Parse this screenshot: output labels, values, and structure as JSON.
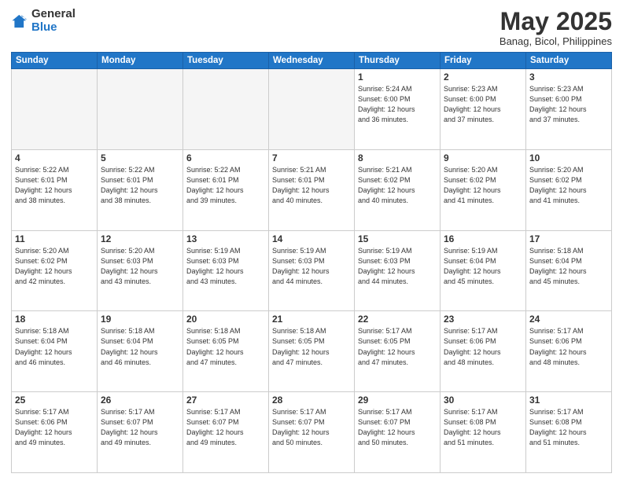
{
  "header": {
    "logo_general": "General",
    "logo_blue": "Blue",
    "month_title": "May 2025",
    "subtitle": "Banag, Bicol, Philippines"
  },
  "weekdays": [
    "Sunday",
    "Monday",
    "Tuesday",
    "Wednesday",
    "Thursday",
    "Friday",
    "Saturday"
  ],
  "weeks": [
    [
      {
        "day": "",
        "info": ""
      },
      {
        "day": "",
        "info": ""
      },
      {
        "day": "",
        "info": ""
      },
      {
        "day": "",
        "info": ""
      },
      {
        "day": "1",
        "info": "Sunrise: 5:24 AM\nSunset: 6:00 PM\nDaylight: 12 hours\nand 36 minutes."
      },
      {
        "day": "2",
        "info": "Sunrise: 5:23 AM\nSunset: 6:00 PM\nDaylight: 12 hours\nand 37 minutes."
      },
      {
        "day": "3",
        "info": "Sunrise: 5:23 AM\nSunset: 6:00 PM\nDaylight: 12 hours\nand 37 minutes."
      }
    ],
    [
      {
        "day": "4",
        "info": "Sunrise: 5:22 AM\nSunset: 6:01 PM\nDaylight: 12 hours\nand 38 minutes."
      },
      {
        "day": "5",
        "info": "Sunrise: 5:22 AM\nSunset: 6:01 PM\nDaylight: 12 hours\nand 38 minutes."
      },
      {
        "day": "6",
        "info": "Sunrise: 5:22 AM\nSunset: 6:01 PM\nDaylight: 12 hours\nand 39 minutes."
      },
      {
        "day": "7",
        "info": "Sunrise: 5:21 AM\nSunset: 6:01 PM\nDaylight: 12 hours\nand 40 minutes."
      },
      {
        "day": "8",
        "info": "Sunrise: 5:21 AM\nSunset: 6:02 PM\nDaylight: 12 hours\nand 40 minutes."
      },
      {
        "day": "9",
        "info": "Sunrise: 5:20 AM\nSunset: 6:02 PM\nDaylight: 12 hours\nand 41 minutes."
      },
      {
        "day": "10",
        "info": "Sunrise: 5:20 AM\nSunset: 6:02 PM\nDaylight: 12 hours\nand 41 minutes."
      }
    ],
    [
      {
        "day": "11",
        "info": "Sunrise: 5:20 AM\nSunset: 6:02 PM\nDaylight: 12 hours\nand 42 minutes."
      },
      {
        "day": "12",
        "info": "Sunrise: 5:20 AM\nSunset: 6:03 PM\nDaylight: 12 hours\nand 43 minutes."
      },
      {
        "day": "13",
        "info": "Sunrise: 5:19 AM\nSunset: 6:03 PM\nDaylight: 12 hours\nand 43 minutes."
      },
      {
        "day": "14",
        "info": "Sunrise: 5:19 AM\nSunset: 6:03 PM\nDaylight: 12 hours\nand 44 minutes."
      },
      {
        "day": "15",
        "info": "Sunrise: 5:19 AM\nSunset: 6:03 PM\nDaylight: 12 hours\nand 44 minutes."
      },
      {
        "day": "16",
        "info": "Sunrise: 5:19 AM\nSunset: 6:04 PM\nDaylight: 12 hours\nand 45 minutes."
      },
      {
        "day": "17",
        "info": "Sunrise: 5:18 AM\nSunset: 6:04 PM\nDaylight: 12 hours\nand 45 minutes."
      }
    ],
    [
      {
        "day": "18",
        "info": "Sunrise: 5:18 AM\nSunset: 6:04 PM\nDaylight: 12 hours\nand 46 minutes."
      },
      {
        "day": "19",
        "info": "Sunrise: 5:18 AM\nSunset: 6:04 PM\nDaylight: 12 hours\nand 46 minutes."
      },
      {
        "day": "20",
        "info": "Sunrise: 5:18 AM\nSunset: 6:05 PM\nDaylight: 12 hours\nand 47 minutes."
      },
      {
        "day": "21",
        "info": "Sunrise: 5:18 AM\nSunset: 6:05 PM\nDaylight: 12 hours\nand 47 minutes."
      },
      {
        "day": "22",
        "info": "Sunrise: 5:17 AM\nSunset: 6:05 PM\nDaylight: 12 hours\nand 47 minutes."
      },
      {
        "day": "23",
        "info": "Sunrise: 5:17 AM\nSunset: 6:06 PM\nDaylight: 12 hours\nand 48 minutes."
      },
      {
        "day": "24",
        "info": "Sunrise: 5:17 AM\nSunset: 6:06 PM\nDaylight: 12 hours\nand 48 minutes."
      }
    ],
    [
      {
        "day": "25",
        "info": "Sunrise: 5:17 AM\nSunset: 6:06 PM\nDaylight: 12 hours\nand 49 minutes."
      },
      {
        "day": "26",
        "info": "Sunrise: 5:17 AM\nSunset: 6:07 PM\nDaylight: 12 hours\nand 49 minutes."
      },
      {
        "day": "27",
        "info": "Sunrise: 5:17 AM\nSunset: 6:07 PM\nDaylight: 12 hours\nand 49 minutes."
      },
      {
        "day": "28",
        "info": "Sunrise: 5:17 AM\nSunset: 6:07 PM\nDaylight: 12 hours\nand 50 minutes."
      },
      {
        "day": "29",
        "info": "Sunrise: 5:17 AM\nSunset: 6:07 PM\nDaylight: 12 hours\nand 50 minutes."
      },
      {
        "day": "30",
        "info": "Sunrise: 5:17 AM\nSunset: 6:08 PM\nDaylight: 12 hours\nand 51 minutes."
      },
      {
        "day": "31",
        "info": "Sunrise: 5:17 AM\nSunset: 6:08 PM\nDaylight: 12 hours\nand 51 minutes."
      }
    ]
  ]
}
